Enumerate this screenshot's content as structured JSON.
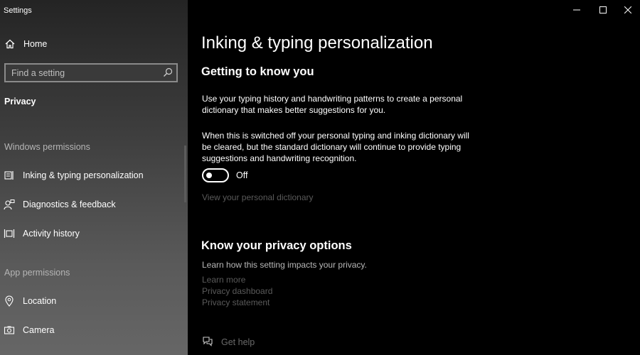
{
  "window": {
    "title": "Settings"
  },
  "sidebar": {
    "home_label": "Home",
    "search_placeholder": "Find a setting",
    "current_section": "Privacy",
    "groups": [
      {
        "header": "Windows permissions",
        "items": [
          {
            "label": "Inking & typing personalization",
            "icon": "pen-icon"
          },
          {
            "label": "Diagnostics & feedback",
            "icon": "person-feedback-icon"
          },
          {
            "label": "Activity history",
            "icon": "timeline-icon"
          }
        ]
      },
      {
        "header": "App permissions",
        "items": [
          {
            "label": "Location",
            "icon": "location-icon"
          },
          {
            "label": "Camera",
            "icon": "camera-icon"
          }
        ]
      }
    ]
  },
  "main": {
    "title": "Inking & typing personalization",
    "section1": {
      "title": "Getting to know you",
      "para1": "Use your typing history and handwriting patterns to create a personal dictionary that makes better suggestions for you.",
      "para2": "When this is switched off your personal typing and inking dictionary will be cleared, but the standard dictionary will continue to provide typing suggestions and handwriting recognition.",
      "toggle_state": "Off",
      "dictionary_link": "View your personal dictionary"
    },
    "section2": {
      "title": "Know your privacy options",
      "note": "Learn how this setting impacts your privacy.",
      "links": [
        "Learn more",
        "Privacy dashboard",
        "Privacy statement"
      ]
    },
    "help_label": "Get help"
  },
  "colors": {
    "background": "#000000",
    "disabled_link": "#5a5a5a",
    "text": "#ffffff"
  }
}
